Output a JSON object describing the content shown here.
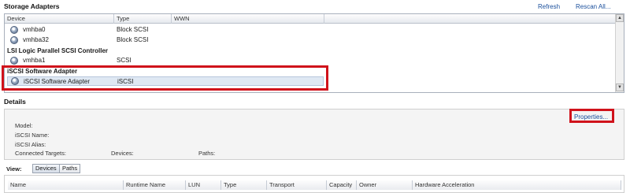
{
  "header": {
    "title": "Storage Adapters",
    "refresh": "Refresh",
    "rescan": "Rescan All..."
  },
  "adapters_table": {
    "columns": [
      "Device",
      "Type",
      "WWN"
    ],
    "groups": [
      {
        "name": "",
        "rows": [
          {
            "device": "vmhba0",
            "type": "Block SCSI"
          },
          {
            "device": "vmhba32",
            "type": "Block SCSI"
          }
        ]
      },
      {
        "name": "LSI Logic Parallel SCSI Controller",
        "rows": [
          {
            "device": "vmhba1",
            "type": "SCSI"
          }
        ]
      },
      {
        "name": "iSCSI Software Adapter",
        "rows": [
          {
            "device": "iSCSI Software Adapter",
            "type": "iSCSI"
          }
        ]
      }
    ]
  },
  "details": {
    "title": "Details",
    "properties": "Properties...",
    "model": "Model:",
    "iscsi_name": "iSCSI Name:",
    "iscsi_alias": "iSCSI Alias:",
    "connected_targets": "Connected Targets:",
    "devices": "Devices:",
    "paths": "Paths:"
  },
  "view": {
    "label": "View:",
    "tabs": [
      "Devices",
      "Paths"
    ],
    "selected": "Devices"
  },
  "bottom_table": {
    "columns": [
      "Name",
      "Runtime Name",
      "LUN",
      "Type",
      "Transport",
      "Capacity",
      "Owner",
      "Hardware Acceleration"
    ]
  },
  "colors": {
    "highlight": "#d0121b",
    "link": "#1a4f9c",
    "selected_row": "#dfe8f3"
  }
}
